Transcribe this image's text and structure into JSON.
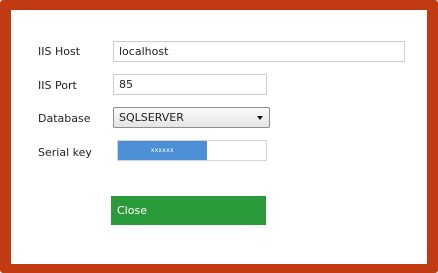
{
  "colors": {
    "frame": "#c23a12",
    "serial_fill": "#4d8fd6",
    "close_button": "#2b9a3b"
  },
  "form": {
    "iis_host": {
      "label": "IIS Host",
      "value": "localhost"
    },
    "iis_port": {
      "label": "IIS Port",
      "value": "85"
    },
    "database": {
      "label": "Database",
      "selected": "SQLSERVER"
    },
    "serial_key": {
      "label": "Serial key",
      "value": "xxxxxx",
      "fill_fraction": 0.6
    }
  },
  "actions": {
    "close_label": "Close"
  }
}
